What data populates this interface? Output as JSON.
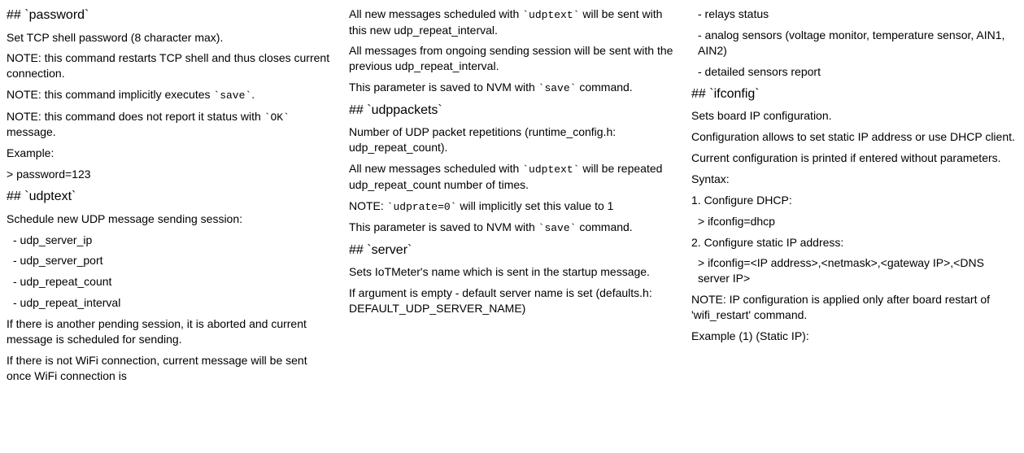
{
  "col1": {
    "password_heading": "## `password`",
    "password_desc": "Set TCP shell password (8 character max).",
    "password_note1": "NOTE: this command restarts TCP shell and thus closes current connection.",
    "password_note2a": "NOTE: this command implicitly executes ",
    "password_note2b": "`save`",
    "password_note2c": ".",
    "password_note3a": "NOTE: this command does not report it status with ",
    "password_note3b": "`OK`",
    "password_note3c": " message.",
    "password_example_label": "Example:",
    "password_example": "> password=123",
    "udptext_heading": "## `udptext`",
    "udptext_desc": "Schedule new UDP message sending session:",
    "udptext_item1": " - udp_server_ip",
    "udptext_item2": " - udp_server_port",
    "udptext_item3": " - udp_repeat_count",
    "udptext_item4": " - udp_repeat_interval",
    "udptext_note1": "If there is another pending session, it is aborted and current message is scheduled for sending.",
    "udptext_note2": "If there is not WiFi connection, current message will be sent once WiFi connection is"
  },
  "col2": {
    "udptext_cont1a": "All new messages scheduled with ",
    "udptext_cont1b": "`udptext`",
    "udptext_cont1c": " will be sent with this new udp_repeat_interval.",
    "udptext_cont2": "All messages from ongoing sending session will be sent with the previous udp_repeat_interval.",
    "udptext_cont3a": "This parameter is saved to NVM with ",
    "udptext_cont3b": "`save`",
    "udptext_cont3c": " command.",
    "udppackets_heading": "## `udppackets`",
    "udppackets_desc": "Number of UDP packet repetitions (runtime_config.h: udp_repeat_count).",
    "udppackets_note1a": "All new messages scheduled with ",
    "udppackets_note1b": "`udptext`",
    "udppackets_note1c": " will be repeated udp_repeat_count number of times.",
    "udppackets_note2a": "NOTE: ",
    "udppackets_note2b": "`udprate=0`",
    "udppackets_note2c": " will implicitly set this value to 1",
    "udppackets_note3a": "This parameter is saved to NVM with ",
    "udppackets_note3b": "`save`",
    "udppackets_note3c": " command.",
    "server_heading": "## `server`",
    "server_desc": "Sets IoTMeter's name which is sent in the startup message.",
    "server_note1": "If argument is empty - default server name is set (defaults.h: DEFAULT_UDP_SERVER_NAME)"
  },
  "col3": {
    "item1": " - relays status",
    "item2": " - analog sensors (voltage monitor, temperature sensor, AIN1, AIN2)",
    "item3": " - detailed sensors report",
    "ifconfig_heading": "## `ifconfig`",
    "ifconfig_desc": "Sets board IP configuration.",
    "ifconfig_note1": "Configuration allows to set static IP address or use DHCP client.",
    "ifconfig_note2": "Current configuration is printed if entered without parameters.",
    "ifconfig_syntax": "Syntax:",
    "ifconfig_dhcp_label": "1. Configure DHCP:",
    "ifconfig_dhcp_cmd": " > ifconfig=dhcp",
    "ifconfig_static_label": "2. Configure static IP address:",
    "ifconfig_static_cmd": " > ifconfig=<IP address>,<netmask>,<gateway IP>,<DNS server IP>",
    "ifconfig_note3": "NOTE: IP configuration is applied only after board restart of 'wifi_restart' command.",
    "ifconfig_example_label": "Example (1) (Static IP):"
  }
}
